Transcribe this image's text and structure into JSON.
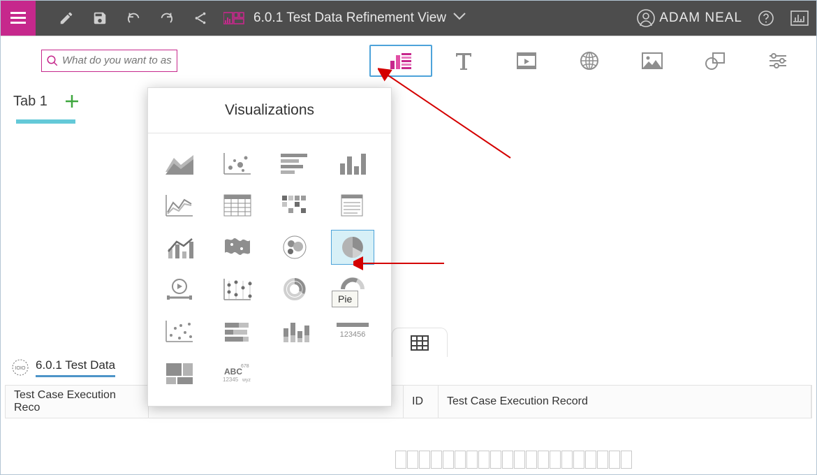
{
  "header": {
    "title": "6.0.1 Test Data Refinement View",
    "user_name": "ADAM NEAL"
  },
  "search": {
    "placeholder": "What do you want to as"
  },
  "tabs": [
    {
      "label": "Tab 1",
      "active": true
    }
  ],
  "toolbar_items": {
    "visualizations": {
      "name": "visualizations",
      "selected": true
    },
    "text": {
      "name": "text"
    },
    "media": {
      "name": "media"
    },
    "web": {
      "name": "web"
    },
    "image": {
      "name": "image"
    },
    "shapes": {
      "name": "shapes"
    },
    "settings": {
      "name": "settings"
    }
  },
  "viz_panel": {
    "title": "Visualizations",
    "items": [
      {
        "name": "area-chart"
      },
      {
        "name": "bubble-chart"
      },
      {
        "name": "horizontal-bar-chart"
      },
      {
        "name": "column-chart"
      },
      {
        "name": "line-chart"
      },
      {
        "name": "crosstab"
      },
      {
        "name": "heatmap"
      },
      {
        "name": "list-summary"
      },
      {
        "name": "combo-chart"
      },
      {
        "name": "map"
      },
      {
        "name": "packed-bubble"
      },
      {
        "name": "pie",
        "hover": true
      },
      {
        "name": "player"
      },
      {
        "name": "point-chart"
      },
      {
        "name": "radial-bar"
      },
      {
        "name": "radial-progress"
      },
      {
        "name": "scatter-plot"
      },
      {
        "name": "stacked-bar"
      },
      {
        "name": "stacked-column"
      },
      {
        "name": "summary-number",
        "label": "123456"
      },
      {
        "name": "treemap"
      },
      {
        "name": "word-cloud"
      }
    ],
    "tooltip": "Pie"
  },
  "data_source": {
    "title": "6.0.1 Test Data",
    "columns": [
      "Test Case Execution Reco",
      "",
      "ID",
      "Test Case Execution Record"
    ]
  }
}
